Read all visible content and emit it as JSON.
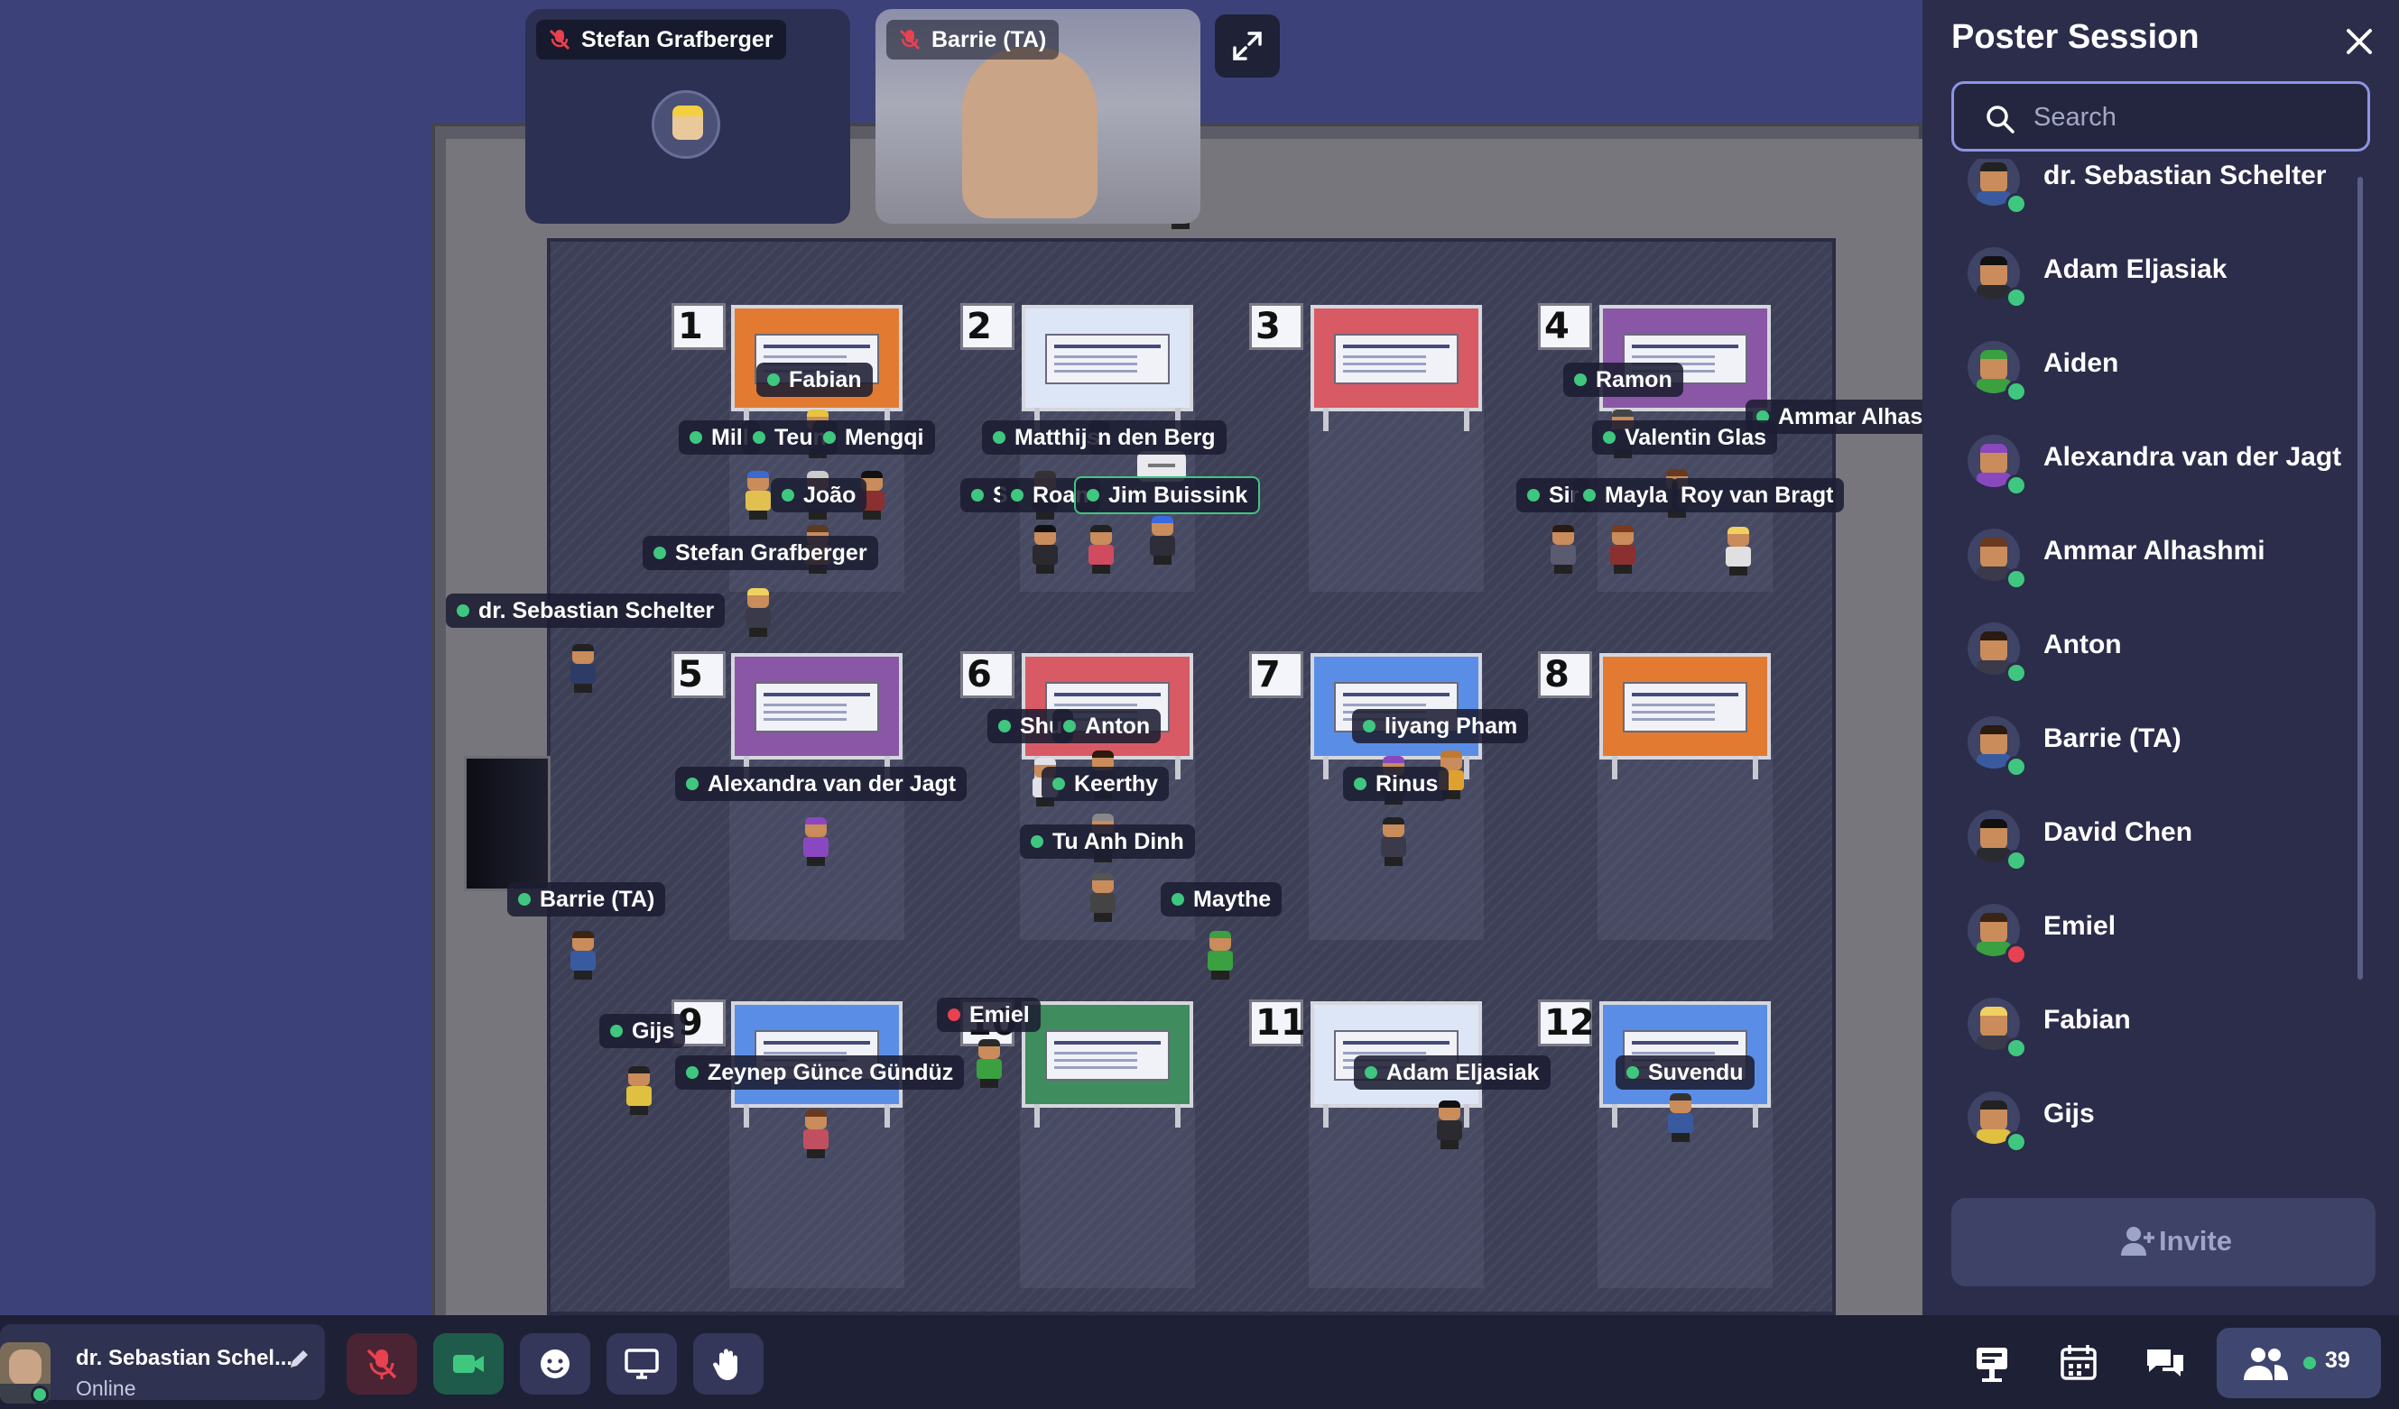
{
  "video_tiles": [
    {
      "name": "Stefan Grafberger",
      "mic": "muted"
    },
    {
      "name": "Barrie (TA)",
      "mic": "muted"
    }
  ],
  "map": {
    "booth_numbers": [
      "1",
      "2",
      "3",
      "4",
      "5",
      "6",
      "7",
      "8",
      "9",
      "10",
      "11",
      "12"
    ],
    "name_tags": [
      {
        "text": "Fabian",
        "status": "online"
      },
      {
        "text": "Mill",
        "status": "online"
      },
      {
        "text": "Teun",
        "status": "online"
      },
      {
        "text": "Mengqi",
        "status": "online"
      },
      {
        "text": "Matthijs",
        "status": "online"
      },
      {
        "text": "n den Berg",
        "status": "none"
      },
      {
        "text": "Ramon",
        "status": "online"
      },
      {
        "text": "Ammar Alhasl",
        "status": "online"
      },
      {
        "text": "Valentin Glas",
        "status": "online"
      },
      {
        "text": "João",
        "status": "online"
      },
      {
        "text": "S",
        "status": "online"
      },
      {
        "text": "Roan",
        "status": "online"
      },
      {
        "text": "Jim Buissink",
        "status": "online"
      },
      {
        "text": "Sir",
        "status": "online"
      },
      {
        "text": "Mayla",
        "status": "online"
      },
      {
        "text": "Roy van Bragt",
        "status": "none"
      },
      {
        "text": "Stefan Grafberger",
        "status": "online"
      },
      {
        "text": "dr. Sebastian Schelter",
        "status": "online"
      },
      {
        "text": "Shu",
        "status": "online"
      },
      {
        "text": "Anton",
        "status": "online"
      },
      {
        "text": "liyang Pham",
        "status": "online"
      },
      {
        "text": "Alexandra van der Jagt",
        "status": "online"
      },
      {
        "text": "Keerthy",
        "status": "online"
      },
      {
        "text": "Rinus",
        "status": "online"
      },
      {
        "text": "Tu Anh Dinh",
        "status": "online"
      },
      {
        "text": "Barrie (TA)",
        "status": "online"
      },
      {
        "text": "Maythe",
        "status": "online"
      },
      {
        "text": "Emiel",
        "status": "busy"
      },
      {
        "text": "Gijs",
        "status": "online"
      },
      {
        "text": "Zeynep Günce Gündüz",
        "status": "online"
      },
      {
        "text": "Adam Eljasiak",
        "status": "online"
      },
      {
        "text": "Suvendu",
        "status": "online"
      }
    ]
  },
  "sidebar": {
    "title": "Poster Session",
    "search_placeholder": "Search",
    "participants": [
      {
        "name": "dr. Sebastian Schelter",
        "status": "online"
      },
      {
        "name": "Adam Eljasiak",
        "status": "online"
      },
      {
        "name": "Aiden",
        "status": "online"
      },
      {
        "name": "Alexandra van der Jagt",
        "status": "online"
      },
      {
        "name": "Ammar Alhashmi",
        "status": "online"
      },
      {
        "name": "Anton",
        "status": "online"
      },
      {
        "name": "Barrie (TA)",
        "status": "online"
      },
      {
        "name": "David Chen",
        "status": "online"
      },
      {
        "name": "Emiel",
        "status": "busy"
      },
      {
        "name": "Fabian",
        "status": "online"
      },
      {
        "name": "Gijs",
        "status": "online"
      }
    ],
    "invite_label": "Invite"
  },
  "bottombar": {
    "user_name": "dr. Sebastian Schel...",
    "user_status": "Online",
    "participant_count": "39"
  },
  "colors": {
    "background": "#3d417a",
    "panel": "#2b2d4a",
    "online": "#3fc780",
    "busy": "#e8414f",
    "accent": "#8c94e6"
  }
}
